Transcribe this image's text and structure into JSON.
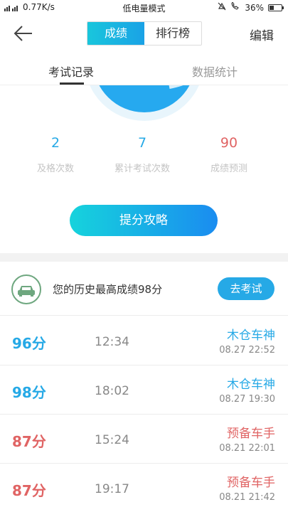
{
  "status_bar": {
    "speed": "0.77K/s",
    "mode": "低电量模式",
    "battery": "36%",
    "battery_level": 0.36
  },
  "header": {
    "tabs": [
      {
        "label": "成绩",
        "active": true
      },
      {
        "label": "排行榜",
        "active": false
      }
    ],
    "edit_label": "编辑"
  },
  "sub_tabs": [
    {
      "label": "考试记录",
      "active": true
    },
    {
      "label": "数据统计",
      "active": false
    }
  ],
  "stats": [
    {
      "value": "2",
      "label": "及格次数",
      "color": "#26a9e6"
    },
    {
      "value": "7",
      "label": "累计考试次数",
      "color": "#26a9e6"
    },
    {
      "value": "90",
      "label": "成绩预测",
      "color": "#e06464"
    }
  ],
  "tips_button": "提分攻略",
  "best": {
    "text": "您的历史最高成绩98分",
    "button": "去考试"
  },
  "records": [
    {
      "score": "96分",
      "duration": "12:34",
      "level": "木仓车神",
      "date": "08.27  22:52",
      "color": "#26a9e6"
    },
    {
      "score": "98分",
      "duration": "18:02",
      "level": "木仓车神",
      "date": "08.27  19:30",
      "color": "#26a9e6"
    },
    {
      "score": "87分",
      "duration": "15:24",
      "level": "预备车手",
      "date": "08.21  22:01",
      "color": "#e06464"
    },
    {
      "score": "87分",
      "duration": "19:17",
      "level": "预备车手",
      "date": "08.21  21:42",
      "color": "#e06464"
    }
  ],
  "colors": {
    "accent": "#26a9e6",
    "fail": "#e06464"
  }
}
